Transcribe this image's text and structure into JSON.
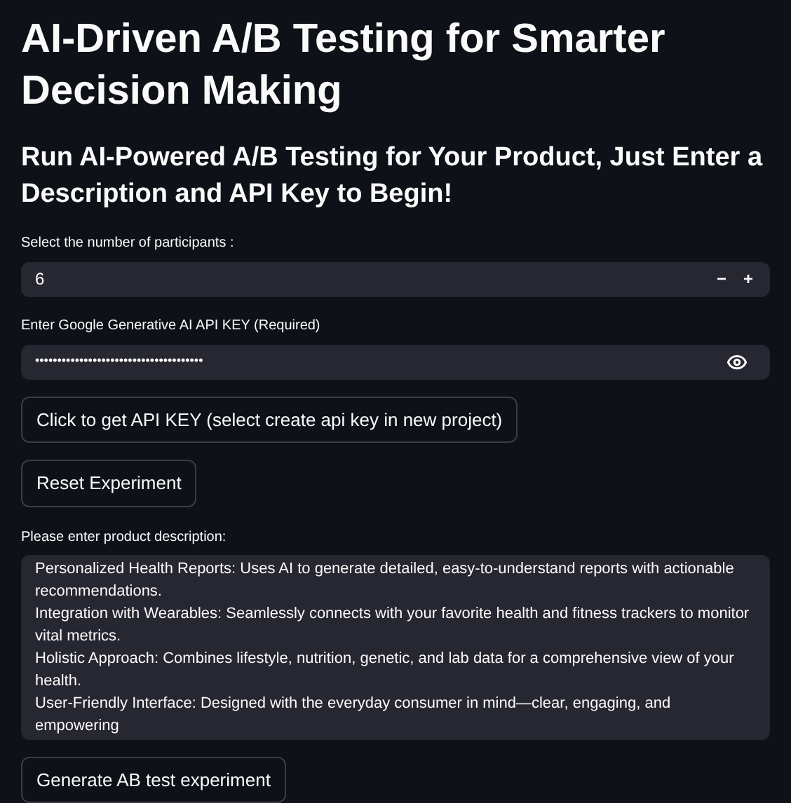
{
  "title": "AI-Driven A/B Testing for Smarter Decision Making",
  "subtitle": "Run AI-Powered A/B Testing for Your Product, Just Enter a Description and API Key to Begin!",
  "participants": {
    "label": "Select the number of participants :",
    "value": "6",
    "decrement": "−",
    "increment": "+"
  },
  "api_key": {
    "label": "Enter Google Generative AI API KEY (Required)",
    "value": "••••••••••••••••••••••••••••••••••••••",
    "masked": true
  },
  "buttons": [
    "Click to get API KEY (select create api key in new project)",
    "Reset Experiment"
  ],
  "description": {
    "label": "Please enter product description:",
    "paragraphs": [
      "Personalized Health Reports: Uses AI to generate detailed, easy-to-understand reports with actionable recommendations.",
      "Integration with Wearables: Seamlessly connects with your favorite health and fitness trackers to monitor vital metrics.",
      "Holistic Approach: Combines lifestyle, nutrition, genetic, and lab data for a comprehensive view of your health.",
      "User-Friendly Interface: Designed with the everyday consumer in mind—clear, engaging, and empowering"
    ]
  },
  "submit": "Generate AB test experiment"
}
